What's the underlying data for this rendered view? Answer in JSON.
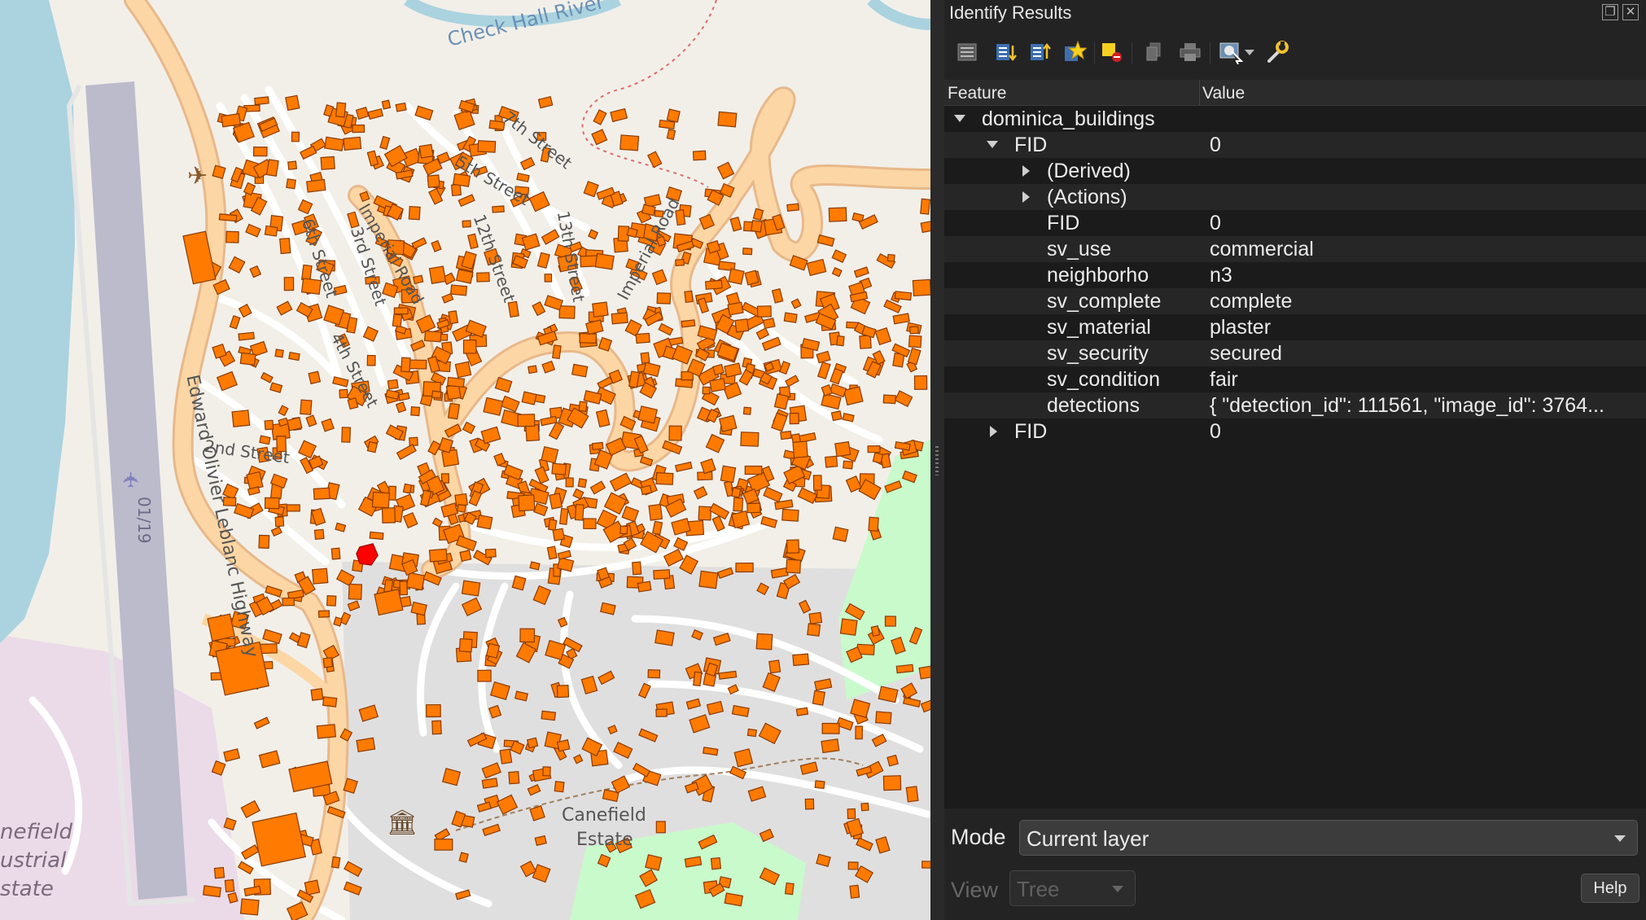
{
  "panel": {
    "title": "Identify Results",
    "window_buttons": [
      "float-icon",
      "close-icon"
    ]
  },
  "toolbar": [
    {
      "name": "expand-tree-icon"
    },
    {
      "name": "expand-all-icon"
    },
    {
      "name": "collapse-all-icon"
    },
    {
      "name": "expand-new-results-icon"
    },
    {
      "name": "clear-highlights-icon"
    },
    {
      "name": "copy-feature-icon"
    },
    {
      "name": "print-icon"
    },
    {
      "name": "identify-select-icon"
    },
    {
      "name": "settings-wrench-icon"
    }
  ],
  "tree": {
    "headers": {
      "feature": "Feature",
      "value": "Value"
    },
    "rows": [
      {
        "label": "dominica_buildings",
        "value": "",
        "arrow": "down",
        "depth": 0
      },
      {
        "label": "FID",
        "value": "0",
        "arrow": "down",
        "depth": 1
      },
      {
        "label": "(Derived)",
        "value": "",
        "arrow": "right",
        "depth": 2
      },
      {
        "label": "(Actions)",
        "value": "",
        "arrow": "right",
        "depth": 2
      },
      {
        "label": "FID",
        "value": "0",
        "arrow": "",
        "depth": 2
      },
      {
        "label": "sv_use",
        "value": "commercial",
        "arrow": "",
        "depth": 2
      },
      {
        "label": "neighborho",
        "value": "n3",
        "arrow": "",
        "depth": 2
      },
      {
        "label": "sv_complete",
        "value": "complete",
        "arrow": "",
        "depth": 2
      },
      {
        "label": "sv_material",
        "value": "plaster",
        "arrow": "",
        "depth": 2
      },
      {
        "label": "sv_security",
        "value": "secured",
        "arrow": "",
        "depth": 2
      },
      {
        "label": "sv_condition",
        "value": "fair",
        "arrow": "",
        "depth": 2
      },
      {
        "label": "detections",
        "value": "{ \"detection_id\": 111561, \"image_id\": 3764...",
        "arrow": "",
        "depth": 2
      },
      {
        "label": "FID",
        "value": "0",
        "arrow": "right",
        "depth": 1
      }
    ]
  },
  "mode": {
    "label": "Mode",
    "value": "Current layer"
  },
  "view": {
    "label": "View",
    "value": "Tree"
  },
  "help_label": "Help",
  "map": {
    "labels": {
      "river": "Check Hall River",
      "street_7th": "7th Street",
      "street_5th": "5th Street",
      "street_12th": "12th Street",
      "street_13th": "13th Street",
      "street_6th": "6th Street",
      "street_3rd": "3rd Street",
      "street_2nd": "2nd Street",
      "street_4th": "4th Street",
      "road_imperial_1": "Imperial Road",
      "road_imperial_2": "Imperial Road",
      "highway": "Edward Olivier Leblanc Highway",
      "runway": "01/19",
      "estate_1": "Canefield",
      "estate_2": "Estate",
      "industrial_1": "nefield",
      "industrial_2": "ustrial",
      "industrial_3": "state"
    },
    "colors": {
      "building": "#ff7a00",
      "building_stroke": "#8a3a00",
      "selected_building": "#ff0000",
      "major_road": "#fcd6a4",
      "minor_road": "#ffffff",
      "water": "#aad3df",
      "runway": "#bbbbcc",
      "residential": "#e0dfdf",
      "industrial": "#ebdbe8",
      "park": "#c8facc"
    }
  }
}
